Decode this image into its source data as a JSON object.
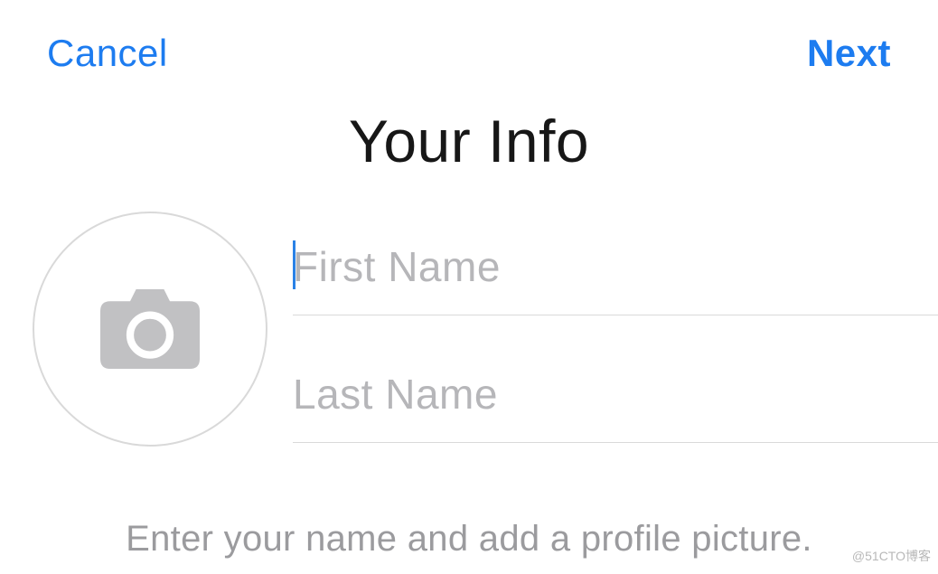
{
  "nav": {
    "cancel": "Cancel",
    "next": "Next"
  },
  "title": "Your Info",
  "fields": {
    "first_name": {
      "placeholder": "First Name",
      "value": ""
    },
    "last_name": {
      "placeholder": "Last Name",
      "value": ""
    }
  },
  "hint": "Enter your name and add a profile picture.",
  "icons": {
    "avatar": "camera-icon"
  },
  "watermark": "@51CTO博客"
}
